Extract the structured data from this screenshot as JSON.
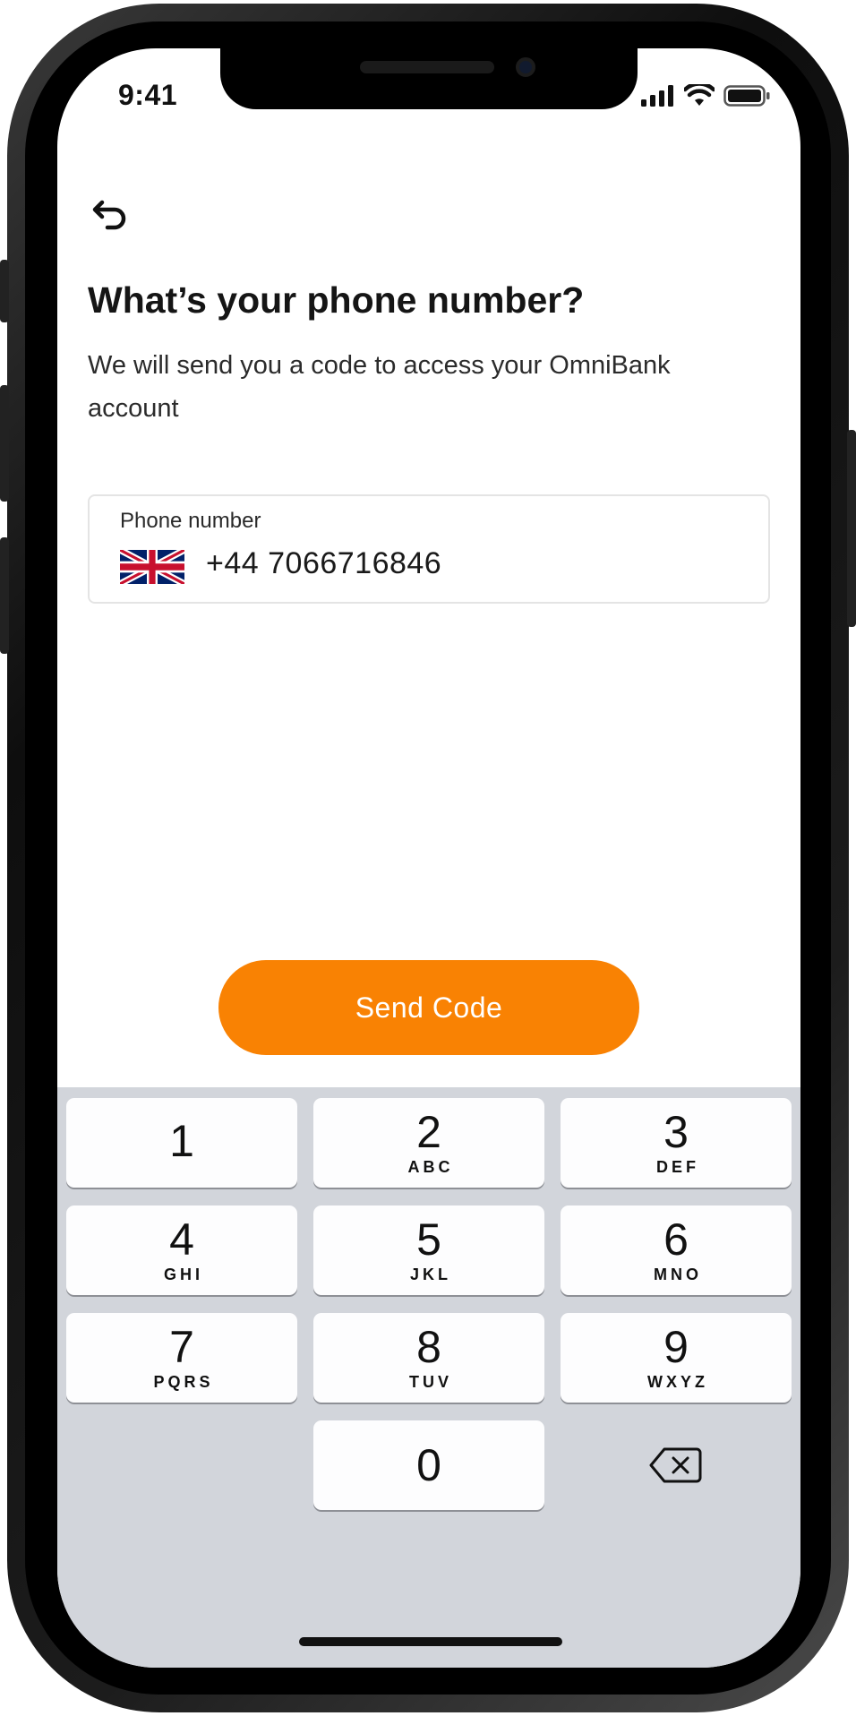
{
  "status_bar": {
    "time": "9:41",
    "icons": [
      "signal-icon",
      "wifi-icon",
      "battery-icon"
    ]
  },
  "header": {
    "back_icon": "back-arrow-icon"
  },
  "main": {
    "title": "What’s your phone number?",
    "subtitle": "We will send you a code to access your OmniBank account",
    "phone_field": {
      "label": "Phone number",
      "country_flag": "uk-flag-icon",
      "value": "+44 7066716846"
    },
    "send_button_label": "Send Code"
  },
  "keypad": {
    "keys": [
      {
        "digit": "1",
        "letters": ""
      },
      {
        "digit": "2",
        "letters": "ABC"
      },
      {
        "digit": "3",
        "letters": "DEF"
      },
      {
        "digit": "4",
        "letters": "GHI"
      },
      {
        "digit": "5",
        "letters": "JKL"
      },
      {
        "digit": "6",
        "letters": "MNO"
      },
      {
        "digit": "7",
        "letters": "PQRS"
      },
      {
        "digit": "8",
        "letters": "TUV"
      },
      {
        "digit": "9",
        "letters": "WXYZ"
      },
      {
        "digit": "0",
        "letters": ""
      }
    ],
    "delete_icon": "backspace-icon"
  },
  "colors": {
    "accent": "#f98203",
    "keyboard_bg": "#d2d5db",
    "key_bg": "#fdfdfe",
    "text_primary": "#151515"
  }
}
